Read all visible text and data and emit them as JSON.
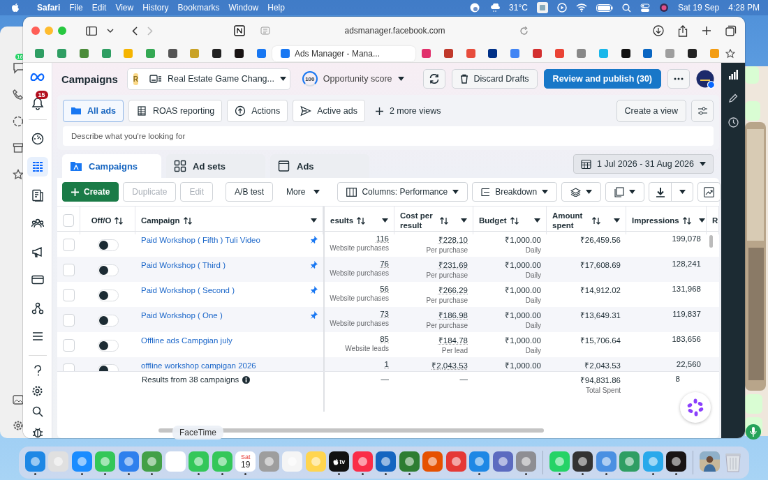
{
  "menubar": {
    "app": "Safari",
    "menus": [
      "File",
      "Edit",
      "View",
      "History",
      "Bookmarks",
      "Window",
      "Help"
    ],
    "weather": "31°C",
    "date": "Sat 19 Sep",
    "time": "4:28 PM"
  },
  "background_app": {
    "badge": "16"
  },
  "browser": {
    "url": "adsmanager.facebook.com",
    "tabs": [
      {
        "color": "#2f9e63",
        "selected": false
      },
      {
        "color": "#2f9e63",
        "selected": false
      },
      {
        "color": "#4c8c3a",
        "selected": false
      },
      {
        "color": "#2f9e63",
        "selected": false
      },
      {
        "color": "#f5b400",
        "selected": false
      },
      {
        "color": "#34a853",
        "selected": false
      },
      {
        "color": "#555555",
        "selected": false
      },
      {
        "color": "#c9a227",
        "selected": false
      },
      {
        "color": "#222222",
        "selected": false
      },
      {
        "color": "#191414",
        "selected": false
      },
      {
        "color": "#1877f2",
        "selected": false
      },
      {
        "label": "Ads Manager - Mana...",
        "color": "#1877f2",
        "selected": true
      },
      {
        "color": "#e1306c",
        "selected": false
      },
      {
        "color": "#c0392b",
        "selected": false
      },
      {
        "color": "#e74c3c",
        "selected": false
      },
      {
        "color": "#003087",
        "selected": false
      },
      {
        "color": "#4285f4",
        "selected": false
      },
      {
        "color": "#d32f2f",
        "selected": false
      },
      {
        "color": "#ea4335",
        "selected": false
      },
      {
        "color": "#888888",
        "selected": false
      },
      {
        "color": "#1ab7ea",
        "selected": false
      },
      {
        "color": "#111111",
        "selected": false
      },
      {
        "color": "#0a66c2",
        "selected": false
      },
      {
        "color": "#9e9e9e",
        "selected": false
      },
      {
        "color": "#222222",
        "selected": false
      },
      {
        "color": "#f39c12",
        "selected": false
      }
    ]
  },
  "page": {
    "title": "Campaigns",
    "account_initial": "R",
    "account_name": "Real Estate Game Chang...",
    "score": "100",
    "score_label": "Opportunity score",
    "discard": "Discard Drafts",
    "publish": "Review and publish (30)",
    "notifications": "15",
    "nav": [
      {
        "selected": false
      },
      {
        "selected": true
      },
      {
        "selected": false
      },
      {
        "selected": false
      },
      {
        "selected": false
      },
      {
        "selected": false
      },
      {
        "selected": false
      },
      {
        "selected": false
      }
    ],
    "views": [
      {
        "label": "All ads",
        "selected": true
      },
      {
        "label": "ROAS reporting",
        "selected": false
      },
      {
        "label": "Actions",
        "selected": false
      },
      {
        "label": "Active ads",
        "selected": false
      }
    ],
    "more_views": "2 more views",
    "create_view": "Create a view",
    "search": {
      "placeholder": "Describe what you're looking for"
    },
    "levels": [
      {
        "label": "Campaigns",
        "selected": true
      },
      {
        "label": "Ad sets",
        "selected": false
      },
      {
        "label": "Ads",
        "selected": false
      }
    ],
    "date_range": "1 Jul 2026 - 31 Aug 2026",
    "actions": [
      {
        "label": "Create",
        "kind": "primary",
        "disabled": false
      },
      {
        "label": "Duplicate",
        "kind": "plain",
        "disabled": true
      },
      {
        "label": "Edit",
        "kind": "plain",
        "disabled": true
      },
      {
        "label": "A/B test",
        "kind": "plain",
        "disabled": false
      },
      {
        "label": "More",
        "kind": "menu",
        "disabled": false
      }
    ],
    "columns_menu": "Columns: Performance",
    "breakdown": "Breakdown"
  },
  "table": {
    "select_all_checked": false,
    "columns": [
      "Off/O",
      "Campaign",
      "esults",
      "Cost per result",
      "Budget",
      "Amount spent",
      "Impressions",
      "R"
    ],
    "rows": [
      {
        "checked": false,
        "on": false,
        "name": "Paid Workshop ( Fifth ) Tuli Video",
        "pinned": true,
        "results": "116",
        "result_type": "Website purchases",
        "cost": "₹228.10",
        "cost_type": "Per purchase",
        "budget": "₹1,000.00",
        "budget_type": "Daily",
        "spent": "₹26,459.56",
        "impressions": "199,078"
      },
      {
        "checked": false,
        "on": false,
        "name": "Paid Workshop ( Third )",
        "pinned": true,
        "results": "76",
        "result_type": "Website purchases",
        "cost": "₹231.69",
        "cost_type": "Per purchase",
        "budget": "₹1,000.00",
        "budget_type": "Daily",
        "spent": "₹17,608.69",
        "impressions": "128,241"
      },
      {
        "checked": false,
        "on": false,
        "name": "Paid Workshop ( Second )",
        "pinned": true,
        "results": "56",
        "result_type": "Website purchases",
        "cost": "₹266.29",
        "cost_type": "Per purchase",
        "budget": "₹1,000.00",
        "budget_type": "Daily",
        "spent": "₹14,912.02",
        "impressions": "131,968"
      },
      {
        "checked": false,
        "on": false,
        "name": "Paid Workshop ( One )",
        "pinned": true,
        "results": "73",
        "result_type": "Website purchases",
        "cost": "₹186.98",
        "cost_type": "Per purchase",
        "budget": "₹1,000.00",
        "budget_type": "Daily",
        "spent": "₹13,649.31",
        "impressions": "119,837"
      },
      {
        "checked": false,
        "on": false,
        "name": "Offline ads Campgian july",
        "pinned": false,
        "results": "85",
        "result_type": "Website leads",
        "cost": "₹184.78",
        "cost_type": "Per lead",
        "budget": "₹1,000.00",
        "budget_type": "Daily",
        "spent": "₹15,706.64",
        "impressions": "183,656"
      },
      {
        "checked": false,
        "on": false,
        "name": "offline workshop campigan 2026",
        "pinned": false,
        "results": "1",
        "cost": "₹2,043.53",
        "budget": "₹1,000.00",
        "spent": "₹2,043.53",
        "impressions": "22,560"
      }
    ],
    "footer": {
      "label": "Results from 38 campaigns",
      "results": "—",
      "cost": "—",
      "spent": "₹94,831.86",
      "spent_label": "Total Spent",
      "impressions": "8"
    }
  },
  "dock": {
    "tooltip": "FaceTime",
    "items": [
      {
        "kind": "app",
        "color": "#1e88e5",
        "running": true
      },
      {
        "kind": "app",
        "color": "#e0e0e0",
        "running": false
      },
      {
        "kind": "app",
        "color": "#1a8cff",
        "running": true
      },
      {
        "kind": "app",
        "color": "#34c759",
        "running": true
      },
      {
        "kind": "app",
        "color": "#2f80ed",
        "running": true
      },
      {
        "kind": "app",
        "color": "#43a047",
        "running": true
      },
      {
        "kind": "app",
        "color": "#ffffff",
        "running": false
      },
      {
        "kind": "app",
        "color": "#34c759",
        "running": true
      },
      {
        "kind": "app",
        "color": "#34c759",
        "running": true
      },
      {
        "kind": "calendar",
        "weekday": "Sat",
        "day": "19",
        "running": true
      },
      {
        "kind": "app",
        "color": "#9e9e9e",
        "running": false
      },
      {
        "kind": "app",
        "color": "#f5f5f5",
        "running": false
      },
      {
        "kind": "app",
        "color": "#ffd54f",
        "running": false
      },
      {
        "kind": "tv",
        "text": "tv",
        "running": true
      },
      {
        "kind": "app",
        "color": "#fa2d48",
        "running": true
      },
      {
        "kind": "app",
        "color": "#1565c0",
        "running": true
      },
      {
        "kind": "app",
        "color": "#2e7d32",
        "running": true
      },
      {
        "kind": "app",
        "color": "#e65100",
        "running": false
      },
      {
        "kind": "app",
        "color": "#e53935",
        "running": false
      },
      {
        "kind": "app",
        "color": "#1e88e5",
        "running": true
      },
      {
        "kind": "app",
        "color": "#5c6bc0",
        "running": false
      },
      {
        "kind": "app",
        "color": "#8e8e93",
        "running": true
      },
      {
        "kind": "separator"
      },
      {
        "kind": "app",
        "color": "#25d366",
        "running": true
      },
      {
        "kind": "app",
        "color": "#333333",
        "running": true
      },
      {
        "kind": "app",
        "color": "#4a90e2",
        "running": true
      },
      {
        "kind": "app",
        "color": "#2f9e63",
        "running": false
      },
      {
        "kind": "app",
        "color": "#29a9eb",
        "running": true
      },
      {
        "kind": "app",
        "color": "#191414",
        "running": true
      },
      {
        "kind": "separator"
      },
      {
        "kind": "picture",
        "running": false
      },
      {
        "kind": "trash",
        "running": false
      }
    ]
  }
}
